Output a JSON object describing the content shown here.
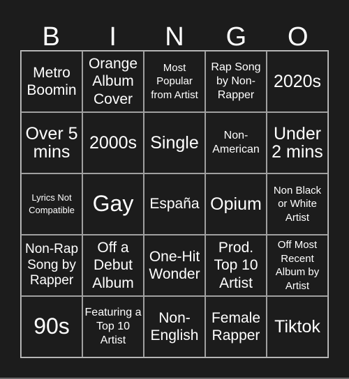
{
  "header": {
    "letters": [
      "B",
      "I",
      "N",
      "G",
      "O"
    ]
  },
  "colors": {
    "background": "#1c1c1c",
    "text": "#ffffff",
    "grid_line": "#a0a0a0"
  },
  "board": {
    "rows": [
      [
        "Metro Boomin",
        "Orange Album Cover",
        "Most Popular from Artist",
        "Rap Song by Non-Rapper",
        "2020s"
      ],
      [
        "Over 5 mins",
        "2000s",
        "Single",
        "Non-American",
        "Under 2 mins"
      ],
      [
        "Lyrics Not Compatible",
        "Gay",
        "España",
        "Opium",
        "Non Black or White Artist"
      ],
      [
        "Non-Rap Song by Rapper",
        "Off a Debut Album",
        "One-Hit Wonder",
        "Prod. Top 10 Artist",
        "Off Most Recent Album by Artist"
      ],
      [
        "90s",
        "Featuring a Top 10 Artist",
        "Non-English",
        "Female Rapper",
        "Tiktok"
      ]
    ]
  }
}
